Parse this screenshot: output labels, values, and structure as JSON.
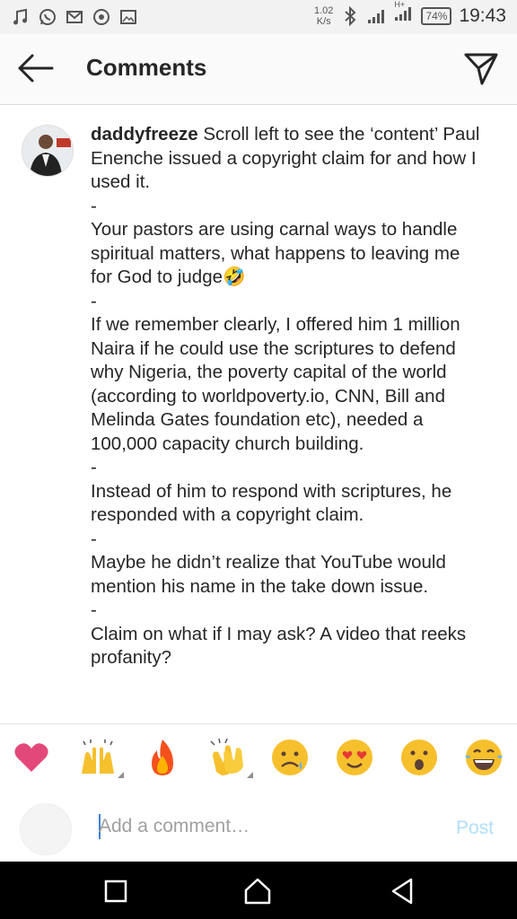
{
  "status_bar": {
    "net_speed_value": "1.02",
    "net_speed_unit": "K/s",
    "network_type": "H+",
    "battery": "74%",
    "time": "19:43"
  },
  "header": {
    "title": "Comments"
  },
  "comment": {
    "username": "daddyfreeze",
    "paragraphs": [
      "Scroll left to see the ‘content’ Paul Enenche issued a copyright claim for and how I used it.",
      "-",
      "Your pastors are using carnal ways to handle spiritual matters, what happens to leaving me for God to judge🤣",
      "-",
      "If we remember clearly, I offered him 1 million Naira if he could use the scriptures to defend why Nigeria, the poverty capital of the world (according to worldpoverty.io, CNN, Bill and Melinda Gates foundation etc), needed a 100,000 capacity church building.",
      "-",
      "Instead of him to respond with scriptures, he responded with a copyright claim.",
      "-",
      "Maybe he didn’t realize that YouTube would mention his name in the take down issue.",
      "-",
      "Claim on what if I may ask? A video that reeks profanity?"
    ]
  },
  "quick_reactions": [
    {
      "icon": "heart-icon",
      "glyph": "❤️"
    },
    {
      "icon": "raising-hands-icon",
      "glyph": "🙌"
    },
    {
      "icon": "fire-icon",
      "glyph": "🔥"
    },
    {
      "icon": "clapping-hands-icon",
      "glyph": "👏"
    },
    {
      "icon": "sad-face-icon",
      "glyph": "😢"
    },
    {
      "icon": "heart-eyes-icon",
      "glyph": "😍"
    },
    {
      "icon": "surprised-face-icon",
      "glyph": "😮"
    },
    {
      "icon": "laughing-face-icon",
      "glyph": "😂"
    }
  ],
  "comment_input": {
    "placeholder": "Add a comment…",
    "post_label": "Post"
  },
  "colors": {
    "post_disabled": "#b2dffc",
    "caret": "#3f7fd6",
    "heart": "#ed4956"
  }
}
